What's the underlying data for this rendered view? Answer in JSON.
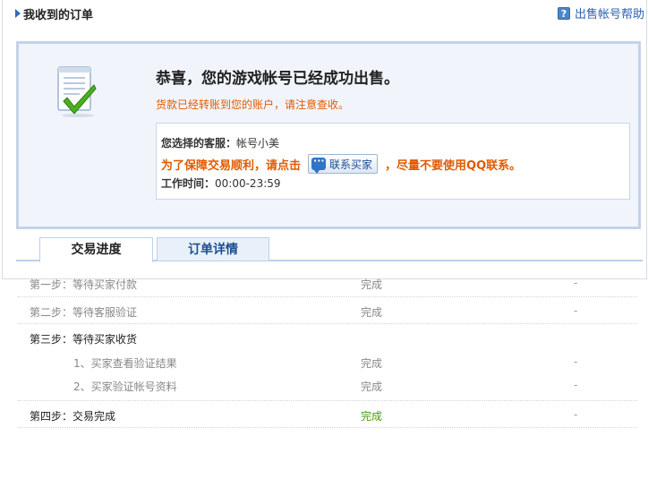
{
  "header": {
    "title": "我收到的订单",
    "help_label": "出售帐号帮助",
    "help_icon": "question-icon"
  },
  "notice": {
    "headline": "恭喜，您的游戏帐号已经成功出售。",
    "subline": "货款已经转账到您的账户，请注意查收。",
    "icon": "document-check-icon",
    "service": {
      "label": "您选择的客服：",
      "name": "帐号小美",
      "tip_before": "为了保障交易顺利，请点击",
      "contact_button": "联系买家",
      "tip_after": "，尽量不要使用QQ联系。",
      "hours_label": "工作时间：",
      "hours_value": "00:00-23:59"
    }
  },
  "tabs": [
    {
      "label": "交易进度",
      "active": true
    },
    {
      "label": "订单详情",
      "active": false
    }
  ],
  "steps": [
    {
      "name": "第一步：等待买家付款",
      "status": "完成",
      "extra": "-"
    },
    {
      "name": "第二步：等待客服验证",
      "status": "完成",
      "extra": "-"
    },
    {
      "name": "第三步：等待买家收货",
      "status": "",
      "extra": ""
    },
    {
      "name": "1、买家查看验证结果",
      "status": "完成",
      "extra": "-"
    },
    {
      "name": "2、买家验证帐号资料",
      "status": "完成",
      "extra": "-"
    },
    {
      "name": "第四步：交易完成",
      "status": "完成",
      "extra": "-"
    }
  ],
  "colors": {
    "accent_blue": "#2a63b1",
    "warning_orange": "#e05a00",
    "success_green": "#4a9a0c",
    "panel_border": "#c2d3e8",
    "panel_bg": "#f1f5fb"
  }
}
